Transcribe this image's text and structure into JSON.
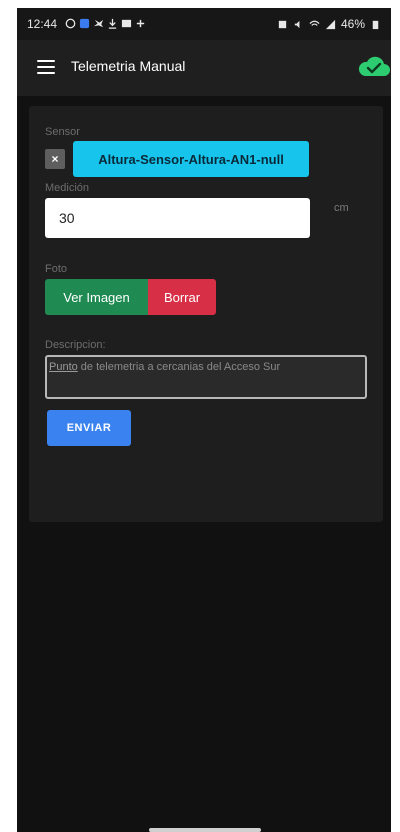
{
  "status_bar": {
    "time": "12:44",
    "battery": "46%"
  },
  "app_bar": {
    "title": "Telemetria Manual",
    "menu_icon": "hamburger-menu-icon",
    "sync_icon": "cloud-check-icon",
    "sync_color": "#2ecc71"
  },
  "form": {
    "sensor_label": "Sensor",
    "sensor_clear": "×",
    "sensor_value": "Altura-Sensor-Altura-AN1-null",
    "medicion_label": "Medición",
    "medicion_value": "30",
    "medicion_unit": "cm",
    "foto_label": "Foto",
    "ver_imagen_label": "Ver Imagen",
    "borrar_label": "Borrar",
    "descripcion_label": "Descripcion:",
    "descripcion_first_word": "Punto",
    "descripcion_rest": " de telemetria a cercanias del Acceso Sur",
    "enviar_label": "ENVIAR"
  },
  "colors": {
    "sensor_chip": "#17c5ec",
    "ver_imagen": "#1f8a52",
    "borrar": "#d72f45",
    "enviar": "#3a82f0"
  }
}
